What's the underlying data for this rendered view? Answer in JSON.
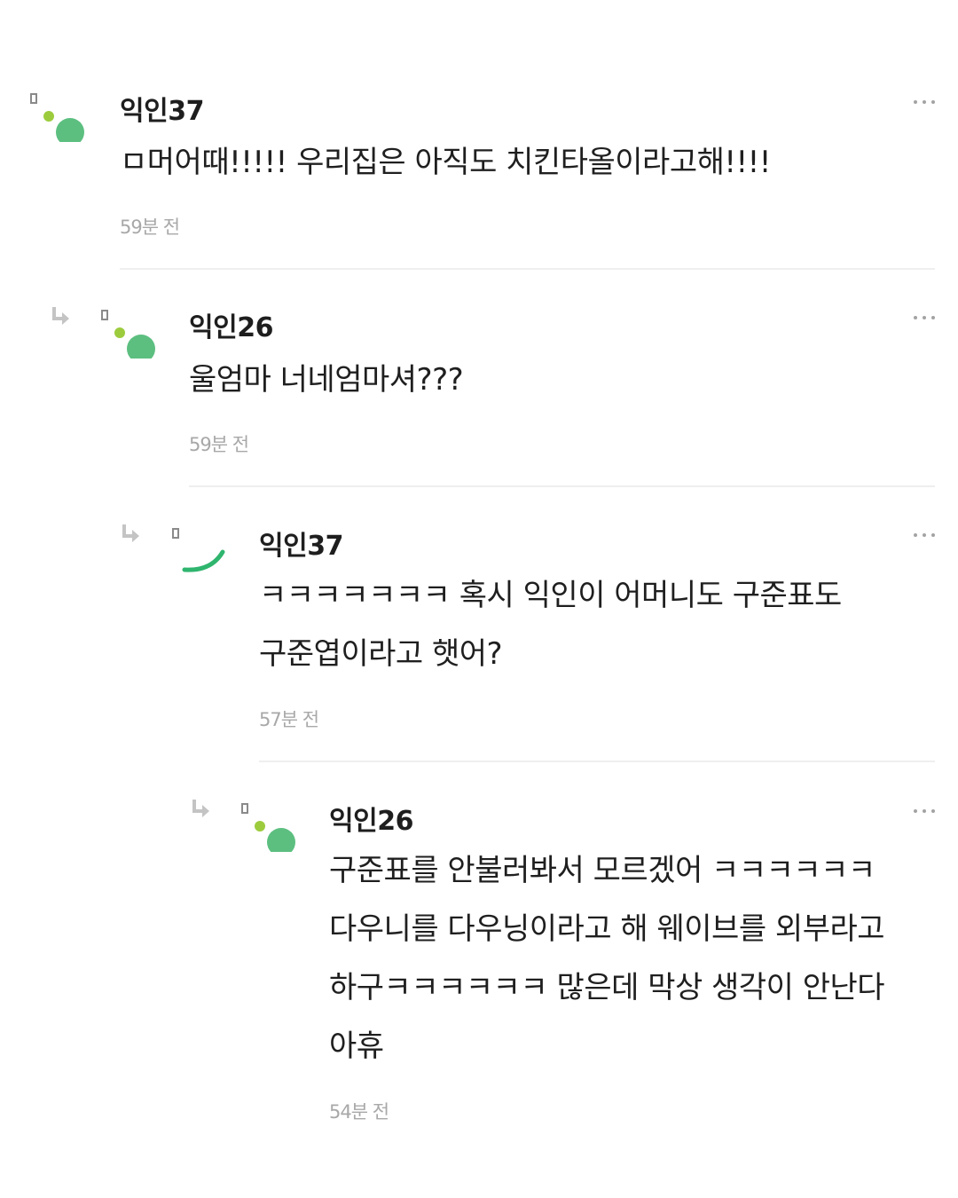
{
  "comments": [
    {
      "author": "익인37",
      "text": "ㅁ머어때!!!!! 우리집은 아직도 치킨타올이라고해!!!!",
      "time": "59분 전",
      "is_reply": false
    },
    {
      "author": "익인26",
      "text": "울엄마 너네엄마셔???",
      "time": "59분 전",
      "is_reply": true
    },
    {
      "author": "익인37",
      "text": "ㅋㅋㅋㅋㅋㅋㅋ 혹시 익인이 어머니도 구준표도 구준엽이라고 햇어?",
      "time": "57분 전",
      "is_reply": true
    },
    {
      "author": "익인26",
      "text": "구준표를 안불러봐서 모르겠어 ㅋㅋㅋㅋㅋㅋ 다우니를 다우닝이라고 해 웨이브를 외부라고 하구ㅋㅋㅋㅋㅋㅋ 많은데 막상 생각이 안난다 아휴",
      "time": "54분 전",
      "is_reply": true
    }
  ],
  "icons": {
    "reply": "reply-arrow-icon",
    "avatar": "avatar-icon",
    "more": "more-options-icon"
  },
  "colors": {
    "avatar_green": "#5cbf80",
    "avatar_lime": "#9ccc3d",
    "reply_arrow": "#c4c4c4",
    "author": "#1e1e1e",
    "timestamp": "#a8a8a8"
  }
}
